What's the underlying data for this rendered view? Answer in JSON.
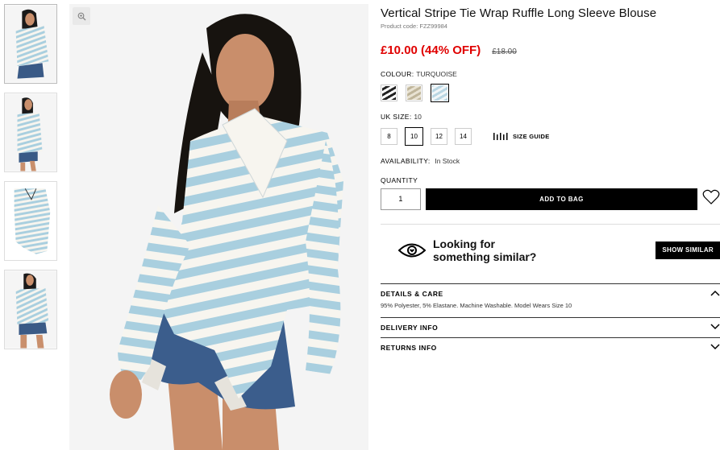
{
  "product": {
    "title": "Vertical Stripe Tie Wrap Ruffle Long Sleeve Blouse",
    "code": "Product code: FZZ99984",
    "price": "£10.00 (44% OFF)",
    "was_price": "£18.00"
  },
  "colour": {
    "label": "COLOUR:",
    "value": "TURQUOISE",
    "swatches": [
      {
        "name": "black-stripe",
        "color": "#222222"
      },
      {
        "name": "stone-stripe",
        "color": "#bfb59a"
      },
      {
        "name": "turquoise-stripe",
        "color": "#b9d6e3"
      }
    ]
  },
  "size": {
    "label": "UK SIZE:",
    "value": "10",
    "options": [
      "8",
      "10",
      "12",
      "14"
    ],
    "guide_label": "SIZE GUIDE"
  },
  "availability": {
    "label": "AVAILABILITY:",
    "value": "In Stock"
  },
  "quantity": {
    "label": "QUANTITY",
    "value": "1"
  },
  "actions": {
    "add_to_bag": "ADD TO BAG"
  },
  "similar": {
    "line1": "Looking for",
    "line2": "something similar?",
    "button": "SHOW SIMILAR"
  },
  "accordion": [
    {
      "title": "DETAILS & CARE",
      "body": "95% Polyester, 5% Elastane. Machine Washable. Model Wears Size 10",
      "open": true
    },
    {
      "title": "DELIVERY INFO",
      "open": false
    },
    {
      "title": "RETURNS INFO",
      "open": false
    }
  ],
  "colors": {
    "sale": "#e00000",
    "stripe_blue": "#a9cfdf",
    "stripe_white": "#f7f5ef"
  },
  "icons": [
    "zoom-icon",
    "size-guide-icon",
    "heart-icon",
    "eye-icon",
    "chevron-up-icon",
    "chevron-down-icon"
  ]
}
